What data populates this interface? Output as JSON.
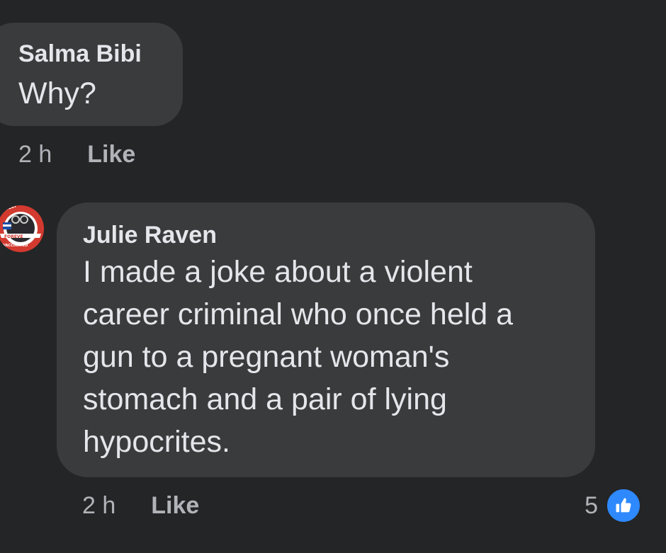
{
  "comments": [
    {
      "author": "Salma Bibi",
      "text": "Why?",
      "time": "2 h",
      "like_label": "Like"
    },
    {
      "author": "Julie Raven",
      "text_lines": [
        "I made a joke about a violent",
        "career criminal who once held a",
        "gun to a pregnant woman's",
        "stomach and a pair of lying",
        "hypocrites."
      ],
      "time": "2 h",
      "like_label": "Like",
      "reaction_count": "5",
      "reaction_icon": "thumbs-up-icon",
      "avatar_icon": "avatar-badge-icon",
      "avatar_badge_text": [
        "FULLY",
        "FOREVE",
        "VACCINATED"
      ]
    }
  ],
  "colors": {
    "background": "#242526",
    "bubble": "#3a3b3c",
    "primary_text": "#e4e6eb",
    "secondary_text": "#b0b3b8",
    "like_blue": "#2e89ff"
  }
}
